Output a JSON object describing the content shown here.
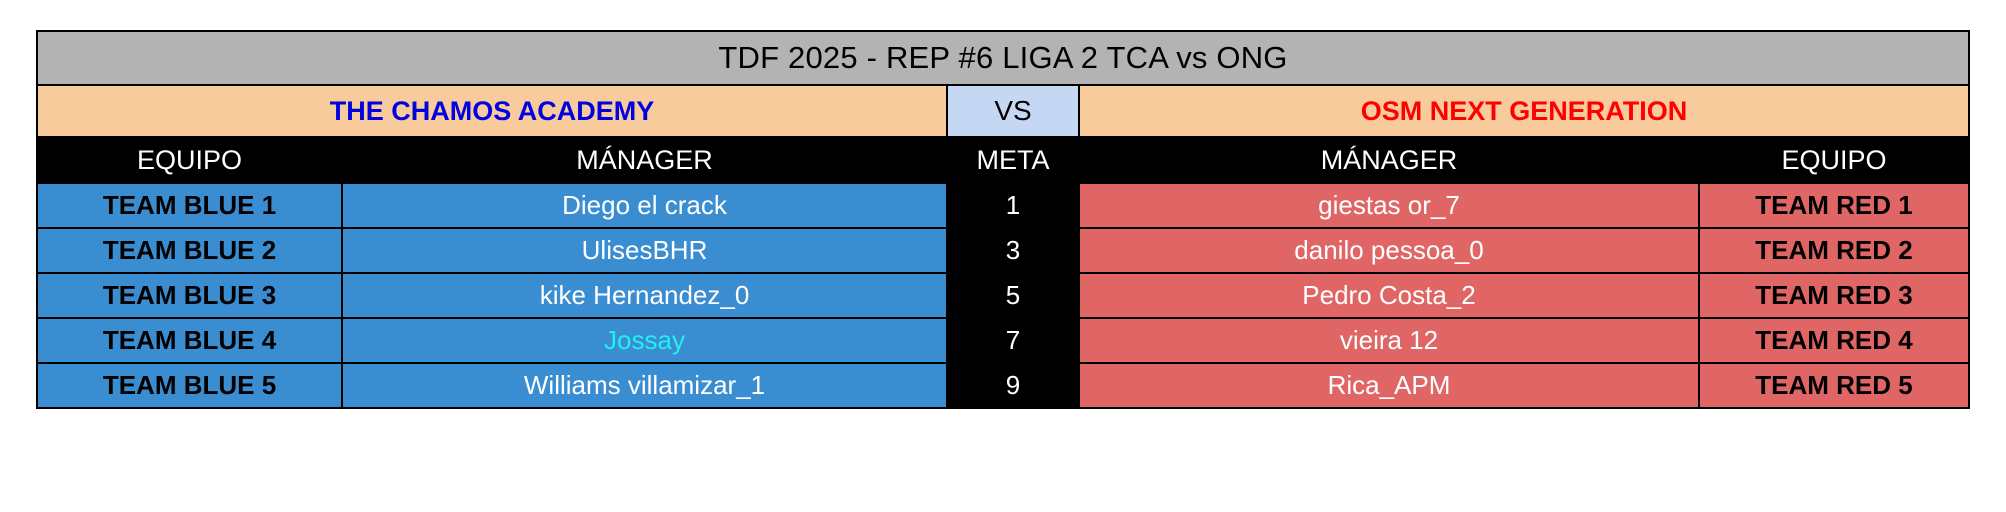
{
  "title": "TDF 2025 - REP #6 LIGA 2 TCA vs ONG",
  "teams": {
    "left_name": "THE CHAMOS ACADEMY",
    "vs_label": "VS",
    "right_name": "OSM NEXT GENERATION"
  },
  "headers": {
    "equipo_left": "EQUIPO",
    "manager_left": "MÁNAGER",
    "meta": "META",
    "manager_right": "MÁNAGER",
    "equipo_right": "EQUIPO"
  },
  "colors": {
    "title_bg": "#b3b3b3",
    "team_bg": "#f8cb9c",
    "vs_bg": "#c4d8f3",
    "left_team_text": "#0000e0",
    "right_team_text": "#ff0000",
    "blue_cell": "#3a8dd0",
    "red_cell": "#e06666",
    "header_bg": "#000000",
    "highlight": "#21f0f0"
  },
  "rows": [
    {
      "team_blue": "TEAM BLUE 1",
      "manager_blue": "Diego el crack",
      "meta": "1",
      "manager_red": "giestas or_7",
      "team_red": "TEAM RED 1",
      "blue_highlight": false
    },
    {
      "team_blue": "TEAM BLUE 2",
      "manager_blue": "UlisesBHR",
      "meta": "3",
      "manager_red": "danilo pessoa_0",
      "team_red": "TEAM RED 2",
      "blue_highlight": false
    },
    {
      "team_blue": "TEAM BLUE 3",
      "manager_blue": "kike Hernandez_0",
      "meta": "5",
      "manager_red": "Pedro Costa_2",
      "team_red": "TEAM RED 3",
      "blue_highlight": false
    },
    {
      "team_blue": "TEAM BLUE 4",
      "manager_blue": "Jossay",
      "meta": "7",
      "manager_red": "vieira 12",
      "team_red": "TEAM RED 4",
      "blue_highlight": true
    },
    {
      "team_blue": "TEAM BLUE 5",
      "manager_blue": "Williams villamizar_1",
      "meta": "9",
      "manager_red": "Rica_APM",
      "team_red": "TEAM RED 5",
      "blue_highlight": false
    }
  ]
}
